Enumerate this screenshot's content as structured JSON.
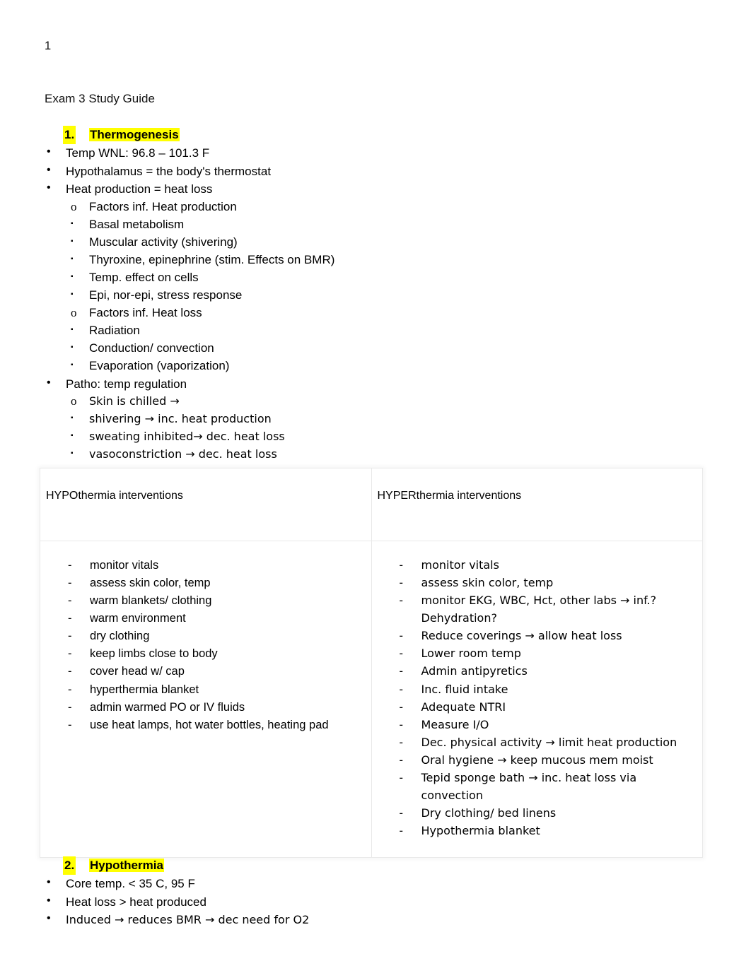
{
  "page": {
    "number": "1",
    "title": "Exam 3 Study Guide",
    "highlight_color": "#FFFF00",
    "arrow_glyph": "→",
    "bullet_disc": "•",
    "bullet_circle": "o",
    "bullet_square": "▪",
    "dash": "-"
  },
  "sections": [
    {
      "number": "1.",
      "heading": "Thermogenesis",
      "bullets": [
        {
          "text": "Temp WNL:  96.8 – 101.3 F"
        },
        {
          "text": "Hypothalamus = the body's thermostat"
        },
        {
          "text": "Heat production = heat loss"
        }
      ],
      "sub": [
        {
          "label": "Factors inf. Heat production",
          "items": [
            "Basal metabolism",
            "Muscular activity (shivering)",
            "Thyroxine, epinephrine (stim. Effects on BMR)",
            "Temp. effect on cells",
            "Epi, nor-epi, stress response"
          ]
        },
        {
          "label": "Factors inf. Heat loss",
          "items": [
            "Radiation",
            "Conduction/ convection",
            "Evaporation (vaporization)"
          ]
        }
      ],
      "patho": {
        "label": "Patho: temp regulation",
        "sub_label": "Skin is chilled →",
        "items": [
          "shivering → inc. heat production",
          "sweating inhibited→ dec. heat loss",
          "vasoconstriction → dec. heat loss"
        ]
      }
    },
    {
      "number": "2.",
      "heading": "Hypothermia",
      "bullets": [
        {
          "text": "Core temp. < 35 C, 95 F"
        },
        {
          "text": "Heat loss > heat produced"
        },
        {
          "text": "Induced → reduces BMR → dec need for O2"
        }
      ]
    }
  ],
  "table": {
    "columns": [
      {
        "header": "HYPOthermia interventions",
        "items": [
          "monitor vitals",
          "assess skin color, temp",
          "warm blankets/ clothing",
          "warm environment",
          "dry clothing",
          "keep limbs close to body",
          "cover head w/ cap",
          "hyperthermia blanket",
          "admin warmed PO or IV fluids",
          "use heat lamps, hot water bottles, heating pad"
        ]
      },
      {
        "header": "HYPERthermia interventions",
        "items": [
          "monitor vitals",
          "assess skin color, temp",
          "monitor EKG, WBC, Hct, other labs → inf.? Dehydration?",
          "Reduce coverings → allow heat loss",
          "Lower room temp",
          "Admin antipyretics",
          "Inc. fluid intake",
          "Adequate NTRI",
          "Measure I/O",
          "Dec. physical activity → limit heat production",
          "Oral hygiene → keep mucous mem moist",
          "Tepid sponge bath → inc. heat loss via convection",
          "Dry clothing/ bed linens",
          "Hypothermia blanket"
        ]
      }
    ]
  }
}
